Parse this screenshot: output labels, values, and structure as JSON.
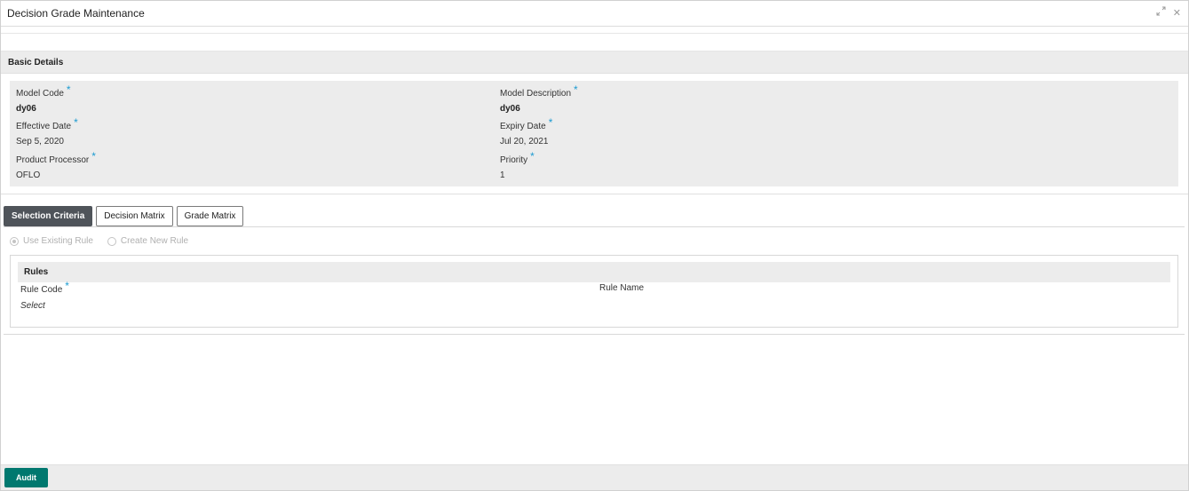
{
  "window": {
    "title": "Decision Grade Maintenance",
    "minimize_icon": "collapse-arrows-icon",
    "close_glyph": "✕"
  },
  "basic_details": {
    "heading": "Basic Details",
    "required_marker": "*",
    "fields": {
      "model_code": {
        "label": "Model Code",
        "value": "dy06"
      },
      "model_description": {
        "label": "Model Description",
        "value": "dy06"
      },
      "effective_date": {
        "label": "Effective Date",
        "value": "Sep 5, 2020"
      },
      "expiry_date": {
        "label": "Expiry Date",
        "value": "Jul 20, 2021"
      },
      "product_processor": {
        "label": "Product Processor",
        "value": "OFLO"
      },
      "priority": {
        "label": "Priority",
        "value": "1"
      }
    }
  },
  "tabs": [
    {
      "label": "Selection Criteria",
      "active": true
    },
    {
      "label": "Decision Matrix",
      "active": false
    },
    {
      "label": "Grade Matrix",
      "active": false
    }
  ],
  "rule_options": {
    "use_existing": {
      "label": "Use Existing Rule",
      "selected": true
    },
    "create_new": {
      "label": "Create New Rule",
      "selected": false
    }
  },
  "rules": {
    "heading": "Rules",
    "rule_code_label": "Rule Code",
    "rule_code_placeholder": "Select",
    "rule_name_label": "Rule Name"
  },
  "footer": {
    "audit_label": "Audit"
  },
  "colors": {
    "accent": "#00786f",
    "required": "#1d9bd1",
    "active_tab": "#4f545a"
  }
}
